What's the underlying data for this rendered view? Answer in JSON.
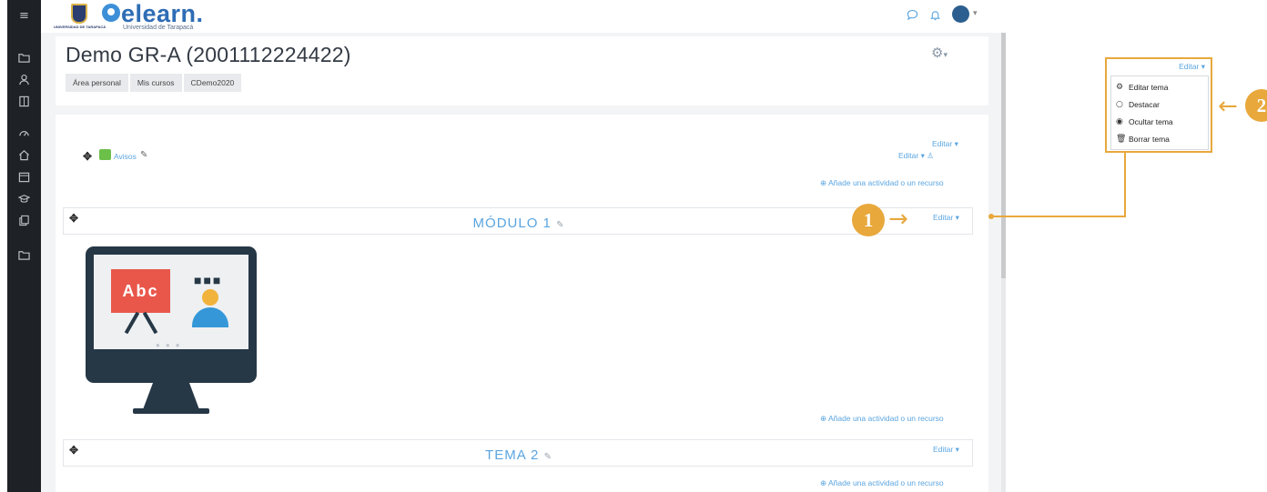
{
  "sidebar": {
    "icons": [
      "menu-icon",
      "folder-icon",
      "user-icon",
      "book-icon",
      "dashboard-icon",
      "home-icon",
      "calendar-icon",
      "graduation-cap-icon",
      "copy-icon",
      "folder-icon"
    ]
  },
  "topbar": {
    "brand": "elearn.",
    "brand_subtitle": "Universidad de Tarapacá",
    "logo_text": "UNIVERSIDAD DE TARAPACÁ"
  },
  "course": {
    "title": "Demo GR-A (2001112224422)",
    "breadcrumbs": [
      "Área personal",
      "Mis cursos",
      "CDemo2020"
    ]
  },
  "sections": {
    "general": {
      "activity_label": "Avisos",
      "edit_label": "Editar",
      "edit2_label": "Editar",
      "add_label": "Añade una actividad o un recurso"
    },
    "modulo1": {
      "title": "MÓDULO 1",
      "edit_label": "Editar",
      "add_label": "Añade una actividad o un recurso",
      "board_text": "Abc"
    },
    "tema2": {
      "title": "TEMA 2",
      "edit_label": "Editar",
      "add_label": "Añade una actividad o un recurso"
    }
  },
  "callouts": {
    "step1": "1",
    "step2": "2"
  },
  "edit_menu": {
    "trigger_label": "Editar",
    "items": [
      {
        "label": "Editar tema",
        "icon": "gear-icon"
      },
      {
        "label": "Destacar",
        "icon": "circle-icon"
      },
      {
        "label": "Ocultar tema",
        "icon": "eye-icon"
      },
      {
        "label": "Borrar tema",
        "icon": "trash-icon"
      }
    ]
  },
  "colors": {
    "sidebar": "#1e2125",
    "accent": "#5aa5e0",
    "callout": "#e8a83c"
  }
}
